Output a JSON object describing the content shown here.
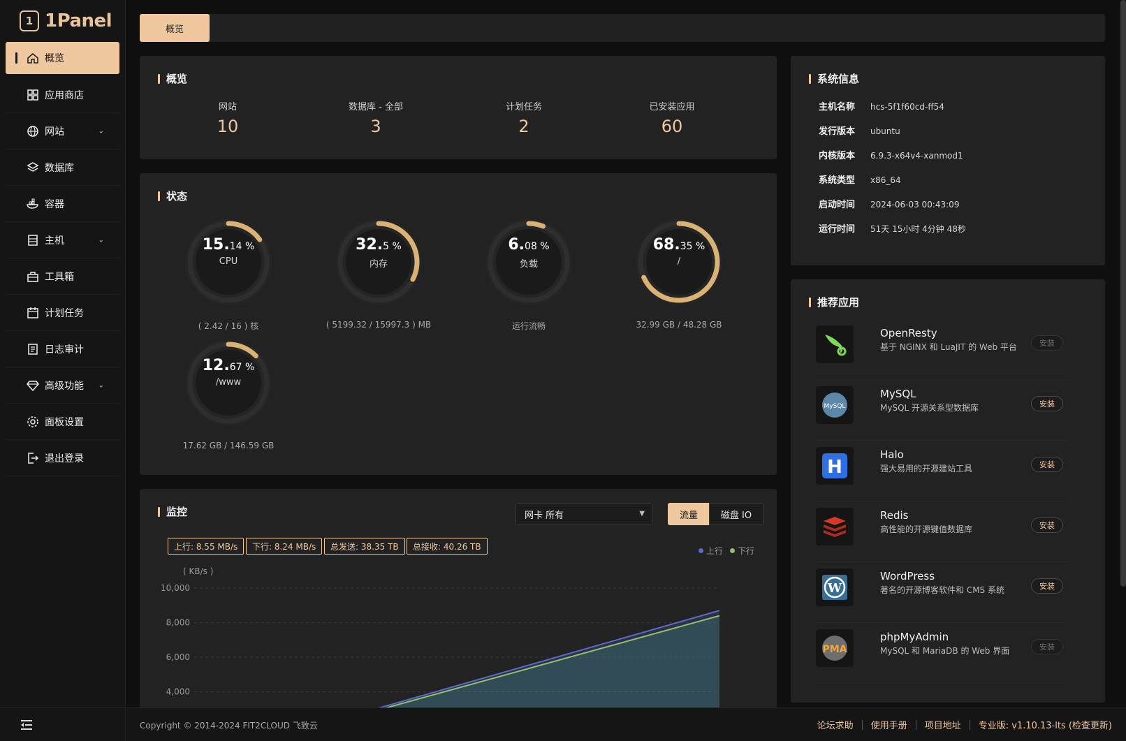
{
  "app": {
    "logo_text": "1Panel"
  },
  "colors": {
    "accent": "#f0c8a0",
    "card": "#222222",
    "upload": "#5b6bc8",
    "download": "#8fbf6f"
  },
  "sidebar": {
    "items": [
      {
        "label": "概览",
        "icon": "home-icon",
        "active": true
      },
      {
        "label": "应用商店",
        "icon": "grid-icon"
      },
      {
        "label": "网站",
        "icon": "globe-icon",
        "expandable": true
      },
      {
        "label": "数据库",
        "icon": "layers-icon"
      },
      {
        "label": "容器",
        "icon": "docker-icon"
      },
      {
        "label": "主机",
        "icon": "server-icon",
        "expandable": true
      },
      {
        "label": "工具箱",
        "icon": "toolbox-icon"
      },
      {
        "label": "计划任务",
        "icon": "calendar-icon"
      },
      {
        "label": "日志审计",
        "icon": "log-icon"
      },
      {
        "label": "高级功能",
        "icon": "diamond-icon",
        "expandable": true
      },
      {
        "label": "面板设置",
        "icon": "gear-icon"
      },
      {
        "label": "退出登录",
        "icon": "logout-icon"
      }
    ]
  },
  "topbar": {
    "tab": "概览"
  },
  "overview": {
    "title": "概览",
    "stats": [
      {
        "label": "网站",
        "value": "10"
      },
      {
        "label": "数据库 - 全部",
        "value": "3"
      },
      {
        "label": "计划任务",
        "value": "2"
      },
      {
        "label": "已安装应用",
        "value": "60"
      }
    ]
  },
  "status": {
    "title": "状态",
    "gauges": [
      {
        "int": "15.",
        "dec": "14 %",
        "name": "CPU",
        "sub": "( 2.42 / 16 ) 核",
        "percent": 15.14
      },
      {
        "int": "32.",
        "dec": "5 %",
        "name": "内存",
        "sub": "( 5199.32 / 15997.3 ) MB",
        "percent": 32.5
      },
      {
        "int": "6.",
        "dec": "08 %",
        "name": "负载",
        "sub": "运行流畅",
        "percent": 6.08
      },
      {
        "int": "68.",
        "dec": "35 %",
        "name": "/",
        "sub": "32.99 GB / 48.28 GB",
        "percent": 68.35
      },
      {
        "int": "12.",
        "dec": "67 %",
        "name": "/www",
        "sub": "17.62 GB / 146.59 GB",
        "percent": 12.67
      }
    ]
  },
  "system": {
    "title": "系统信息",
    "rows": [
      {
        "key": "主机名称",
        "value": "hcs-5f1f60cd-ff54"
      },
      {
        "key": "发行版本",
        "value": "ubuntu"
      },
      {
        "key": "内核版本",
        "value": "6.9.3-x64v4-xanmod1"
      },
      {
        "key": "系统类型",
        "value": "x86_64"
      },
      {
        "key": "启动时间",
        "value": "2024-06-03 00:43:09"
      },
      {
        "key": "运行时间",
        "value": "51天 15小时 4分钟 48秒"
      }
    ]
  },
  "apps": {
    "title": "推荐应用",
    "items": [
      {
        "name": "OpenResty",
        "desc": "基于 NGINX 和 LuaJIT 的 Web 平台",
        "button": "安装",
        "enabled": false,
        "icon": "openresty-logo"
      },
      {
        "name": "MySQL",
        "desc": "MySQL 开源关系型数据库",
        "button": "安装",
        "enabled": true,
        "icon": "mysql-logo"
      },
      {
        "name": "Halo",
        "desc": "强大易用的开源建站工具",
        "button": "安装",
        "enabled": true,
        "icon": "halo-logo"
      },
      {
        "name": "Redis",
        "desc": "高性能的开源键值数据库",
        "button": "安装",
        "enabled": true,
        "icon": "redis-logo"
      },
      {
        "name": "WordPress",
        "desc": "著名的开源博客软件和 CMS 系统",
        "button": "安装",
        "enabled": true,
        "icon": "wordpress-logo"
      },
      {
        "name": "phpMyAdmin",
        "desc": "MySQL 和 MariaDB 的 Web 界面",
        "button": "安装",
        "enabled": false,
        "icon": "phpmyadmin-logo"
      }
    ]
  },
  "monitor": {
    "title": "监控",
    "select_label": "网卡",
    "select_value": "所有",
    "seg_on": "流量",
    "seg_off": "磁盘 IO",
    "tags": [
      "上行: 8.55 MB/s",
      "下行: 8.24 MB/s",
      "总发送: 38.35 TB",
      "总接收: 40.26 TB"
    ],
    "legend_up": "上行",
    "legend_down": "下行",
    "unit": "( KB/s )"
  },
  "chart_data": {
    "type": "area",
    "ylabel": "( KB/s )",
    "yticks": [
      "10,000",
      "8,000",
      "6,000",
      "4,000"
    ],
    "ylim": [
      0,
      10000
    ],
    "series": [
      {
        "name": "上行",
        "values": [
          0,
          8700
        ]
      },
      {
        "name": "下行",
        "values": [
          0,
          8400
        ]
      }
    ]
  },
  "footer": {
    "copyright": "Copyright © 2014-2024 FIT2CLOUD 飞致云",
    "links": [
      "论坛求助",
      "使用手册",
      "项目地址",
      "专业版:  v1.10.13-lts (检查更新)"
    ]
  }
}
